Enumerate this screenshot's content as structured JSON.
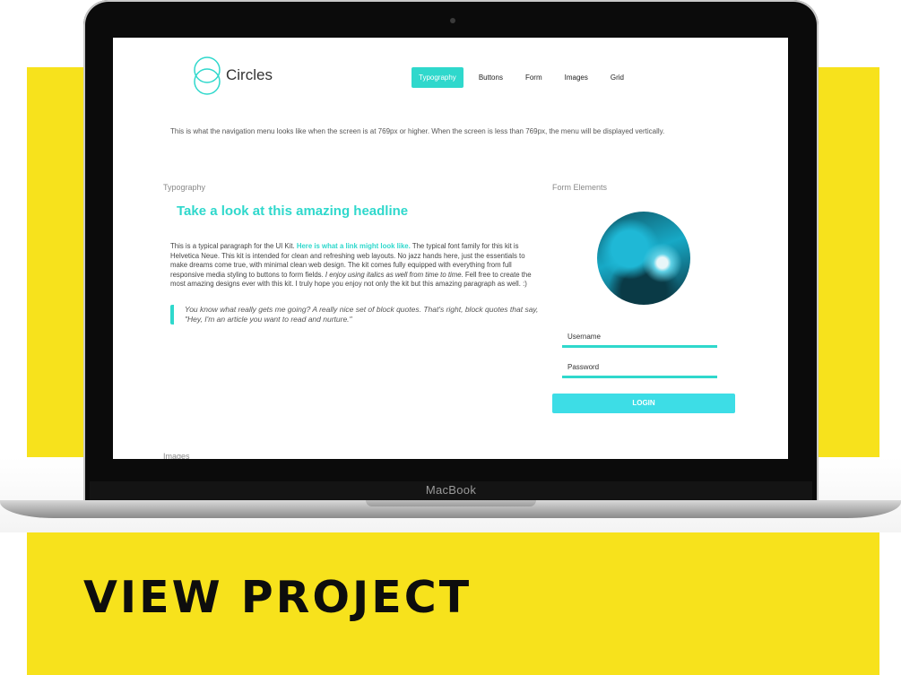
{
  "site": {
    "logo_text": "Circles",
    "nav": [
      {
        "label": "Typography",
        "active": true
      },
      {
        "label": "Buttons",
        "active": false
      },
      {
        "label": "Form",
        "active": false
      },
      {
        "label": "Images",
        "active": false
      },
      {
        "label": "Grid",
        "active": false
      }
    ],
    "intro": "This is what the navigation menu looks like when the screen is at 769px or higher. When the screen is less than 769px, the menu will be displayed vertically.",
    "typography": {
      "label": "Typography",
      "headline": "Take a look at this amazing headline",
      "para_before_link": "This is a typical paragraph for the UI Kit. ",
      "link": "Here is what a link might look like.",
      "para_after_link": " The typical font family for this kit is Helvetica Neue. This kit is intended for clean and refreshing web layouts. No jazz hands here, just the essentials to make dreams come true, with minimal clean web design. The kit comes fully equipped with everything from full responsive media styling to buttons to form fields. ",
      "italic": "I enjoy using italics as well from time to time.",
      "para_end": " Fell free to create the most amazing designs ever with this kit. I truly hope you enjoy not only the kit but this amazing paragraph as well. :)",
      "quote": "You know what really gets me going? A really nice set of block quotes. That's right, block quotes that say, \"Hey, I'm an article you want to read and nurture.\""
    },
    "form": {
      "label": "Form Elements",
      "username_label": "Username",
      "password_label": "Password",
      "login_label": "LOGIN"
    },
    "images_label": "Images"
  },
  "device": {
    "brand": "MacBook"
  },
  "cta": "VIEW PROJECT",
  "colors": {
    "accent": "#2fd8cc",
    "background_panel": "#f7e21c"
  }
}
